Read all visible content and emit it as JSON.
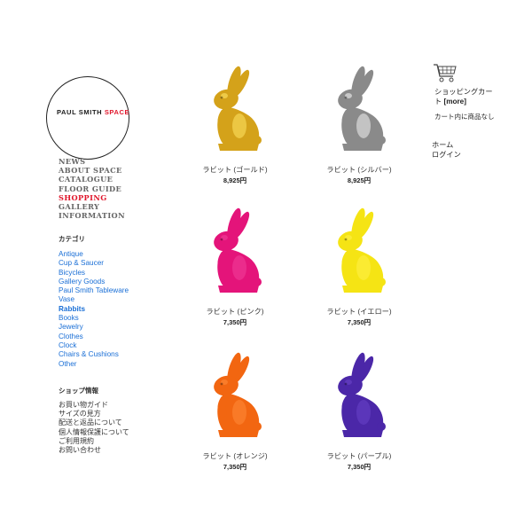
{
  "brand": {
    "name_black": "PAUL SMITH ",
    "name_red": "SPACE"
  },
  "main_nav": [
    {
      "label": "NEWS",
      "active": false
    },
    {
      "label": "ABOUT SPACE",
      "active": false
    },
    {
      "label": "CATALOGUE",
      "active": false
    },
    {
      "label": "FLOOR GUIDE",
      "active": false
    },
    {
      "label": "SHOPPING",
      "active": true
    },
    {
      "label": "GALLERY",
      "active": false
    },
    {
      "label": "INFORMATION",
      "active": false
    }
  ],
  "category": {
    "title": "カテゴリ",
    "items": [
      {
        "label": "Antique",
        "active": false
      },
      {
        "label": "Cup & Saucer",
        "active": false
      },
      {
        "label": "Bicycles",
        "active": false
      },
      {
        "label": "Gallery Goods",
        "active": false
      },
      {
        "label": "Paul Smith Tableware",
        "active": false
      },
      {
        "label": "Vase",
        "active": false
      },
      {
        "label": "Rabbits",
        "active": true
      },
      {
        "label": "Books",
        "active": false
      },
      {
        "label": "Jewelry",
        "active": false
      },
      {
        "label": "Clothes",
        "active": false
      },
      {
        "label": "Clock",
        "active": false
      },
      {
        "label": "Chairs & Cushions",
        "active": false
      },
      {
        "label": "Other",
        "active": false
      }
    ]
  },
  "shop_info": {
    "title": "ショップ情報",
    "items": [
      "お買い物ガイド",
      "サイズの見方",
      "配送と返品について",
      "個人情報保護について",
      "ご利用規約",
      "お問い合わせ"
    ]
  },
  "products": [
    {
      "name": "ラビット (ゴールド)",
      "price": "8,925円",
      "color": "#d4a21a",
      "highlight": "#ffe566"
    },
    {
      "name": "ラビット (シルバー)",
      "price": "8,925円",
      "color": "#8a8a8a",
      "highlight": "#f2f2f2"
    },
    {
      "name": "ラビット (ピンク)",
      "price": "7,350円",
      "color": "#e4147a",
      "highlight": "#f0409a"
    },
    {
      "name": "ラビット (イエロー)",
      "price": "7,350円",
      "color": "#f5e414",
      "highlight": "#fff04a"
    },
    {
      "name": "ラビット (オレンジ)",
      "price": "7,350円",
      "color": "#f26611",
      "highlight": "#ff8a3a"
    },
    {
      "name": "ラビット (パープル)",
      "price": "7,350円",
      "color": "#4b27a8",
      "highlight": "#6a44c8"
    }
  ],
  "cart": {
    "title": "ショッピングカート",
    "more": "[more]",
    "empty": "カート内に商品なし",
    "icon": "cart-icon"
  },
  "right_links": [
    "ホーム",
    "ログイン"
  ]
}
